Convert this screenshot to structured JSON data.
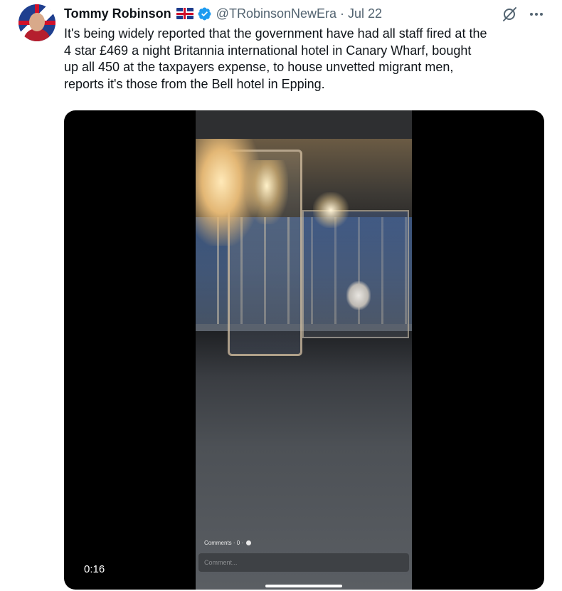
{
  "tweet": {
    "author_name": "Tommy Robinson",
    "author_handle": "@TRobinsonNewEra",
    "separator": "·",
    "date": "Jul 22",
    "text": "It's being widely reported that the government have had all staff fired at the\n4 star £469 a night Britannia  international hotel in Canary Wharf, bought\nup all 450 at the taxpayers expense, to house unvetted migrant men,\nreports it's those from the Bell hotel in Epping.",
    "icons": {
      "avatar": "profile-avatar",
      "flag": "uk-flag-emoji",
      "verified": "verified-badge-icon",
      "grok": "grok-icon",
      "more": "more-options-icon"
    },
    "colors": {
      "secondary_text": "#536471",
      "verified_blue": "#1d9bf0",
      "primary_text": "#0f1419"
    }
  },
  "video": {
    "timecode": "0:16",
    "overlay_comments": "Comments · 0 ·",
    "overlay_comment_placeholder": "Comment..."
  }
}
